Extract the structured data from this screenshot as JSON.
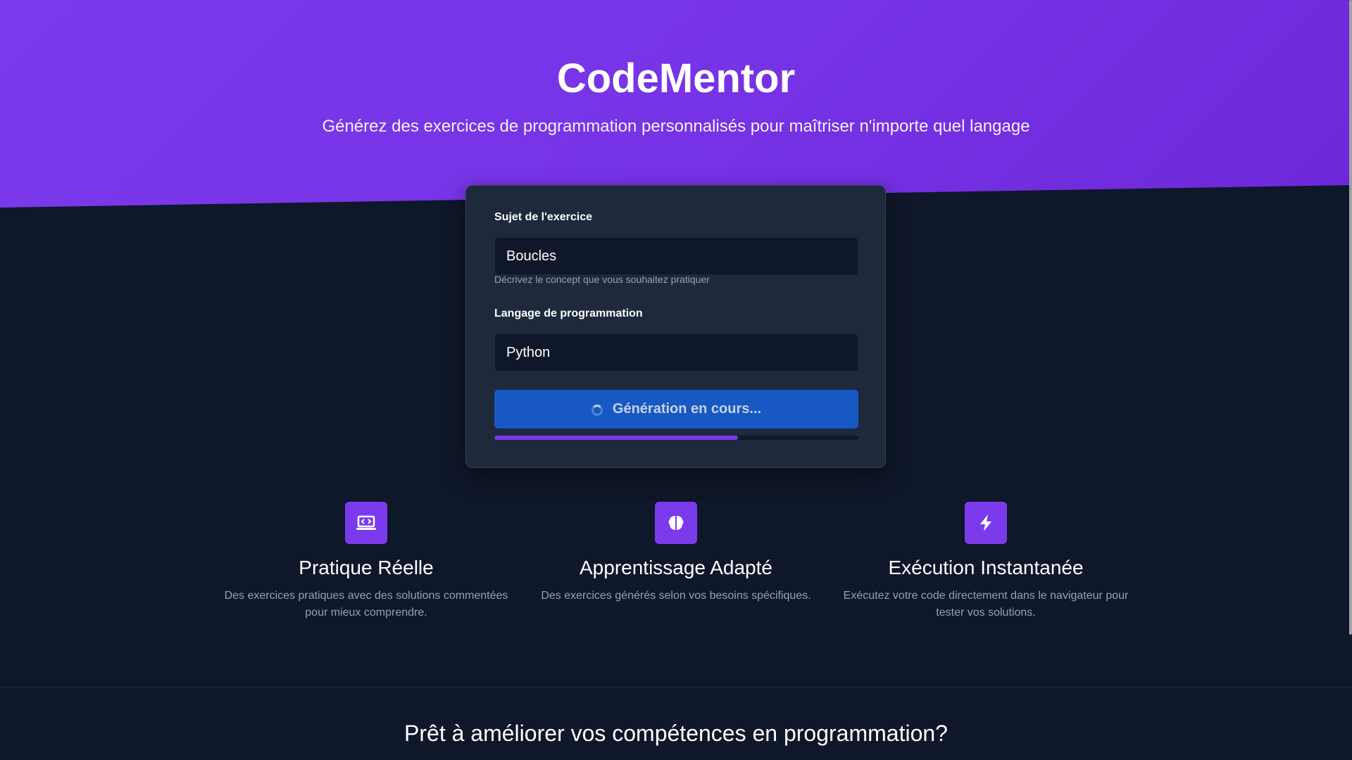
{
  "hero": {
    "title": "CodeMentor",
    "subtitle": "Générez des exercices de programmation personnalisés pour maîtriser n'importe quel langage"
  },
  "form": {
    "subject_label": "Sujet de l'exercice",
    "subject_value": "Boucles",
    "subject_help": "Décrivez le concept que vous souhaitez pratiquer",
    "language_label": "Langage de programmation",
    "language_value": "Python",
    "generate_button_label": "Génération en cours...",
    "progress_percent": 67
  },
  "features": [
    {
      "icon": "laptop-code-icon",
      "title": "Pratique Réelle",
      "description": "Des exercices pratiques avec des solutions commentées pour mieux comprendre."
    },
    {
      "icon": "brain-icon",
      "title": "Apprentissage Adapté",
      "description": "Des exercices générés selon vos besoins spécifiques."
    },
    {
      "icon": "lightning-bolt-icon",
      "title": "Exécution Instantanée",
      "description": "Exécutez votre code directement dans le navigateur pour tester vos solutions."
    }
  ],
  "cta": {
    "title": "Prêt à améliorer vos compétences en programmation?"
  },
  "colors": {
    "accent": "#7c3aed",
    "button": "#1758c4",
    "background": "#0f172a",
    "card": "#1e293b"
  }
}
